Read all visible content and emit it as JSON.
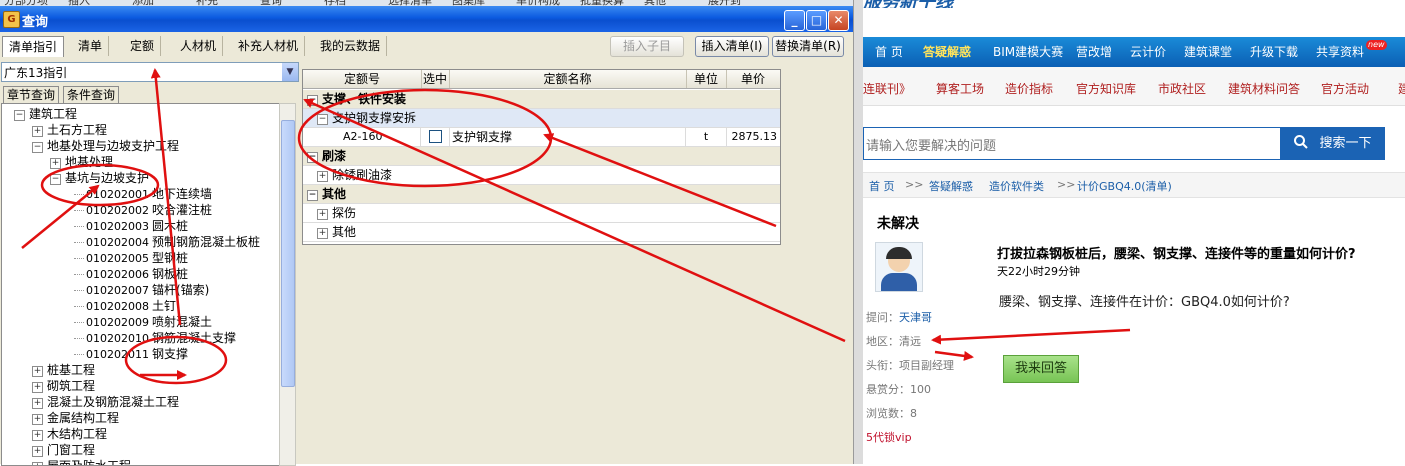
{
  "top_strip": {
    "items": [
      "分部分项",
      "插入",
      "添加",
      "补充",
      "查询",
      "存档",
      "选择清单",
      "图集库",
      "单价构成",
      "批量换算",
      "其他",
      "展开到"
    ]
  },
  "dialog": {
    "title": "查询",
    "tabs": [
      {
        "label": "清单指引"
      },
      {
        "label": "清单"
      },
      {
        "label": "定额"
      },
      {
        "label": "人材机"
      },
      {
        "label": "补充人材机"
      },
      {
        "label": "我的云数据"
      }
    ],
    "buttons": {
      "insert_child": "插入子目",
      "insert_list": "插入清单(I)",
      "replace_list": "替换清单(R)"
    },
    "left": {
      "combo_value": "广东13指引",
      "subtabs": [
        "章节查询",
        "条件查询"
      ],
      "tree": [
        {
          "label": "建筑工程",
          "expander": "−",
          "level": 0
        },
        {
          "label": "土石方工程",
          "expander": "+",
          "level": 1
        },
        {
          "label": "地基处理与边坡支护工程",
          "expander": "−",
          "level": 1
        },
        {
          "label": "地基处理",
          "expander": "+",
          "level": 2
        },
        {
          "label": "基坑与边坡支护",
          "expander": "−",
          "level": 2
        },
        {
          "code": "010202001",
          "label": "地下连续墙"
        },
        {
          "code": "010202002",
          "label": "咬合灌注桩"
        },
        {
          "code": "010202003",
          "label": "圆木桩"
        },
        {
          "code": "010202004",
          "label": "预制钢筋混凝土板桩"
        },
        {
          "code": "010202005",
          "label": "型钢桩"
        },
        {
          "code": "010202006",
          "label": "钢板桩"
        },
        {
          "code": "010202007",
          "label": "锚杆(锚索)"
        },
        {
          "code": "010202008",
          "label": "土钉"
        },
        {
          "code": "010202009",
          "label": "喷射混凝土"
        },
        {
          "code": "010202010",
          "label": "钢筋混凝土支撑"
        },
        {
          "code": "010202011",
          "label": "钢支撑"
        },
        {
          "label": "桩基工程",
          "expander": "+",
          "level": 1
        },
        {
          "label": "砌筑工程",
          "expander": "+",
          "level": 1
        },
        {
          "label": "混凝土及钢筋混凝土工程",
          "expander": "+",
          "level": 1
        },
        {
          "label": "金属结构工程",
          "expander": "+",
          "level": 1
        },
        {
          "label": "木结构工程",
          "expander": "+",
          "level": 1
        },
        {
          "label": "门窗工程",
          "expander": "+",
          "level": 1
        },
        {
          "label": "屋面及防水工程",
          "expander": "+",
          "level": 1
        }
      ]
    },
    "grid": {
      "headers": [
        "定额号",
        "选中",
        "定额名称",
        "单位",
        "单价"
      ],
      "rows": [
        {
          "type": "group",
          "exp": "−",
          "text": "支撑、铁件安装"
        },
        {
          "type": "sub",
          "exp": "−",
          "text": "支护钢支撑安拆"
        },
        {
          "type": "item",
          "code": "A2-160",
          "name": "支护钢支撑",
          "unit": "t",
          "price": "2875.13"
        },
        {
          "type": "group",
          "exp": "−",
          "text": "刷漆"
        },
        {
          "type": "plain",
          "exp": "+",
          "text": "除锈刷油漆"
        },
        {
          "type": "group",
          "exp": "−",
          "text": "其他"
        },
        {
          "type": "plain",
          "exp": "+",
          "text": "探伤"
        },
        {
          "type": "plain",
          "exp": "+",
          "text": "其他"
        }
      ]
    }
  },
  "web": {
    "logo_text": "服务新干线",
    "nav": [
      "首 页",
      "答疑解惑",
      "BIM建模大赛",
      "营改增",
      "云计价",
      "建筑课堂",
      "升级下载",
      "共享资料"
    ],
    "nav_badge": "new",
    "subnav": [
      "连联刊》",
      "算客工场",
      "造价指标",
      "官方知识库",
      "市政社区",
      "建筑材料问答",
      "官方活动",
      "建"
    ],
    "search_placeholder": "请输入您要解决的问题",
    "search_button": "搜索一下",
    "breadcrumb": [
      "首 页",
      ">>",
      "答疑解惑",
      "造价软件类",
      ">>",
      "计价GBQ4.0(清单)"
    ],
    "question": {
      "status": "未解决",
      "title": "打拔拉森钢板桩后，腰梁、钢支撑、连接件等的重量如何计价?",
      "time": "天22小时29分钟",
      "body": "腰梁、钢支撑、连接件在计价：GBQ4.0如何计价?",
      "asker_label": "提问：",
      "asker": "天津哥",
      "region": "地区：清远",
      "title_label": "头衔：项目副经理",
      "bounty": "悬赏分：100",
      "views": "浏览数：8",
      "vip": "5代锁vip",
      "answer_button": "我来回答"
    }
  },
  "annotation_color": "#e01010"
}
